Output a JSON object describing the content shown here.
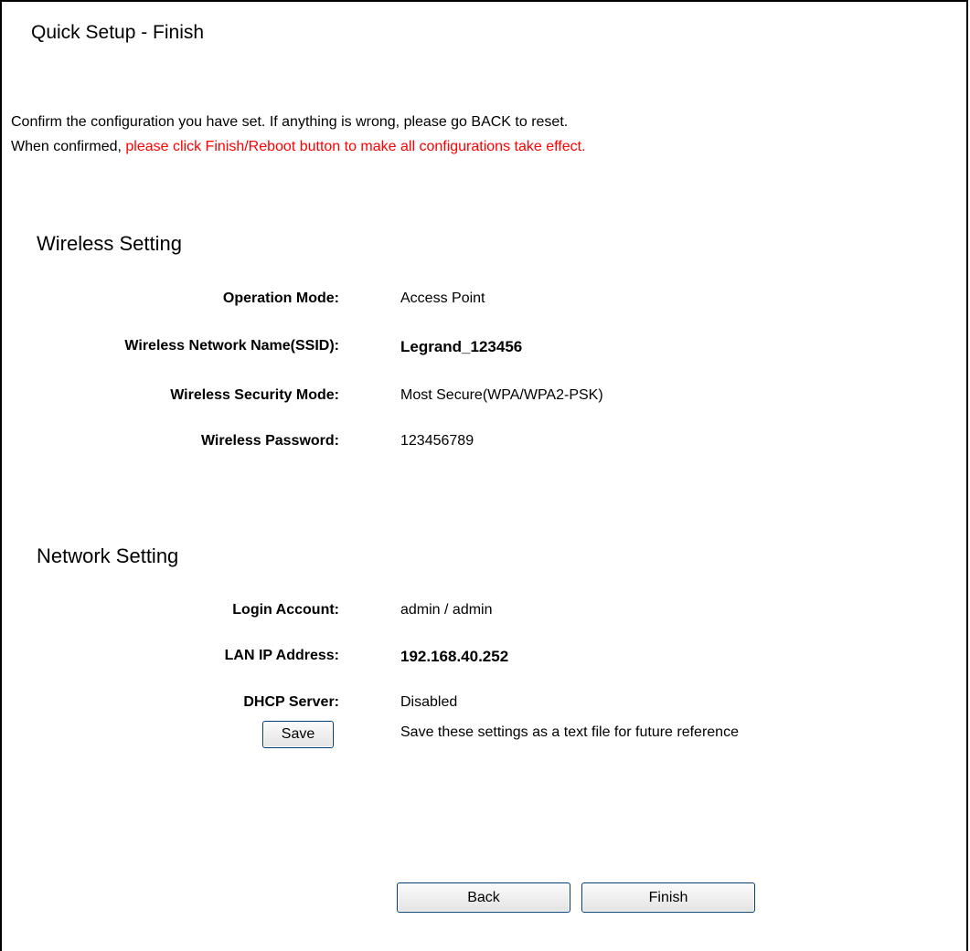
{
  "title": "Quick Setup - Finish",
  "intro": {
    "line1": "Confirm the configuration you have set. If anything is wrong, please go BACK to reset.",
    "line2_prefix": "When confirmed, ",
    "line2_red": "please click Finish/Reboot button to make all configurations take effect."
  },
  "wireless": {
    "heading": "Wireless Setting",
    "rows": [
      {
        "label": "Operation Mode:",
        "value": "Access Point"
      },
      {
        "label": "Wireless Network Name(SSID):",
        "value": "Legrand_123456"
      },
      {
        "label": "Wireless Security Mode:",
        "value": "Most Secure(WPA/WPA2-PSK)"
      },
      {
        "label": "Wireless Password:",
        "value": "123456789"
      }
    ]
  },
  "network": {
    "heading": "Network Setting",
    "rows": [
      {
        "label": "Login Account:",
        "value": "admin / admin"
      },
      {
        "label": "LAN IP Address:",
        "value": "192.168.40.252"
      },
      {
        "label": "DHCP Server:",
        "value": "Disabled"
      }
    ]
  },
  "save": {
    "button_label": "Save",
    "note": "Save these settings as a text file for future reference"
  },
  "nav": {
    "back_label": "Back",
    "finish_label": "Finish"
  },
  "colors": {
    "warning_text": "#ff0000",
    "button_border": "#003c74"
  }
}
